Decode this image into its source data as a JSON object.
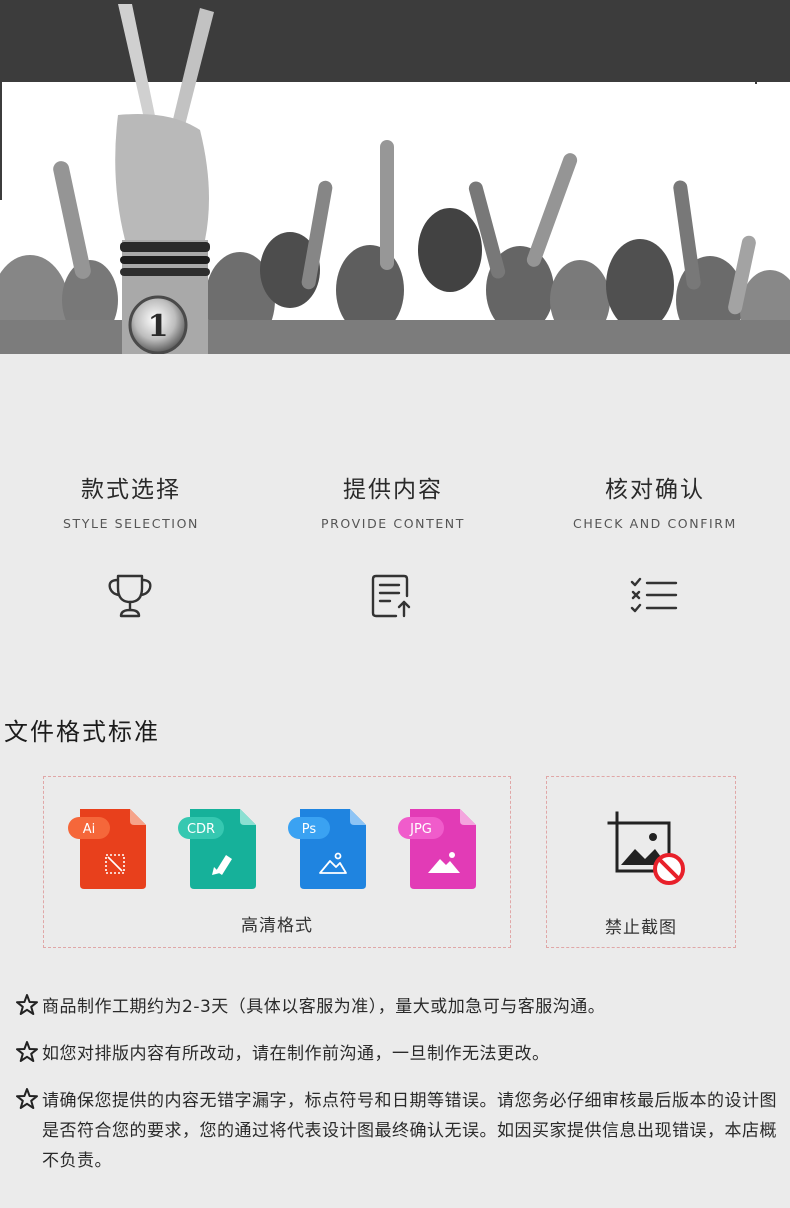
{
  "steps": [
    {
      "title": "款式选择",
      "subtitle": "STYLE SELECTION",
      "icon": "trophy-icon"
    },
    {
      "title": "提供内容",
      "subtitle": "PROVIDE CONTENT",
      "icon": "document-upload-icon"
    },
    {
      "title": "核对确认",
      "subtitle": "CHECK AND CONFIRM",
      "icon": "checklist-icon"
    }
  ],
  "format_section": {
    "title": "文件格式标准",
    "formats": [
      {
        "label": "Ai",
        "color": "#e8401c",
        "tab": "#f5673a"
      },
      {
        "label": "CDR",
        "color": "#16b19a",
        "tab": "#36c8b1"
      },
      {
        "label": "Ps",
        "color": "#1f84e0",
        "tab": "#3aa2f2"
      },
      {
        "label": "JPG",
        "color": "#e23bb6",
        "tab": "#f05ccb"
      }
    ],
    "formats_caption": "高清格式",
    "forbid_caption": "禁止截图"
  },
  "notes": [
    "商品制作工期约为2-3天（具体以客服为准），量大或加急可与客服沟通。",
    "如您对排版内容有所改动，请在制作前沟通，一旦制作无法更改。",
    "请确保您提供的内容无错字漏字，标点符号和日期等错误。请您务必仔细审核最后版本的设计图是否符合您的要求，您的通过将代表设计图最终确认无误。如因买家提供信息出现错误，本店概不负责。"
  ]
}
